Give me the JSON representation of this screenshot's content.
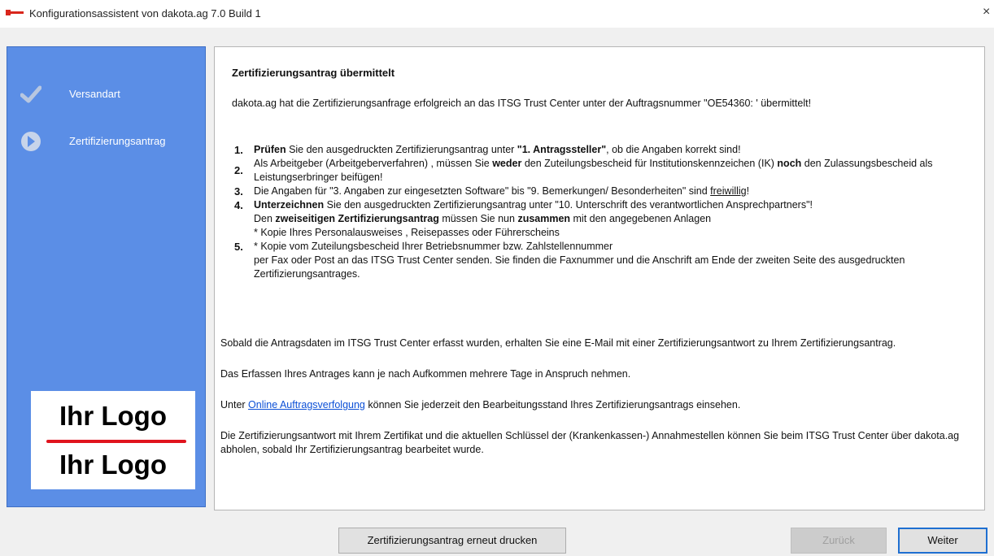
{
  "window": {
    "title": "Konfigurationsassistent von dakota.ag 7.0 Build 1",
    "close": "×"
  },
  "sidebar": {
    "steps": [
      {
        "label": "Versandart",
        "icon": "checkmark-icon",
        "state": "done"
      },
      {
        "label": "Zertifizierungsantrag",
        "icon": "arrow-circle-icon",
        "state": "current"
      }
    ],
    "logo_top": "Ihr Logo",
    "logo_bottom": "Ihr Logo"
  },
  "content": {
    "title": "Zertifizierungsantrag übermittelt",
    "intro": "dakota.ag hat die Zertifizierungsanfrage erfolgreich an das ITSG Trust Center unter der Auftragsnummer \"OE54360: ' übermittelt!",
    "list": {
      "n1": "1.",
      "i1_bold": "Prüfen",
      "i1_rest1": " Sie den ausgedruckten Zertifizierungsantrag unter ",
      "i1_bold2": "\"1. Antragssteller\"",
      "i1_rest2": ", ob die Angaben korrekt sind!",
      "n2": "2.",
      "i2_a": "Als Arbeitgeber (Arbeitgeberverfahren) , müssen Sie ",
      "i2_bold1": "weder",
      "i2_b": " den Zuteilungsbescheid für Institutionskennzeichen (IK) ",
      "i2_bold2": "noch",
      "i2_c": " den Zulassungsbescheid als Leistungserbringer beifügen!",
      "n3": "3.",
      "i3_a": "Die Angaben für \"3. Angaben zur eingesetzten Software\" bis \"9. Bemerkungen/ Besonderheiten\" sind ",
      "i3_u": "freiwillig",
      "i3_b": "!",
      "n4": "4.",
      "i4_bold": "Unterzeichnen",
      "i4_rest": " Sie den ausgedruckten Zertifizierungsantrag unter \"10. Unterschrift des verantwortlichen Ansprechpartners\"!",
      "n5": "5.",
      "i5_a": "Den ",
      "i5_bold1": "zweiseitigen Zertifizierungsantrag",
      "i5_b": " müssen Sie nun ",
      "i5_bold2": "zusammen",
      "i5_c": " mit den angegebenen Anlagen",
      "i5_d": "* Kopie Ihres Personalausweises , Reisepasses oder Führerscheins",
      "i5_e": "* Kopie vom Zuteilungsbescheid Ihrer Betriebsnummer bzw. Zahlstellennummer",
      "i5_f": "per Fax oder Post an das ITSG Trust Center senden. Sie finden die Faxnummer und die Anschrift am Ende der zweiten Seite des ausgedruckten Zertifizierungsantrages."
    },
    "p1": "Sobald die Antragsdaten im ITSG Trust Center erfasst wurden, erhalten Sie eine E-Mail mit einer Zertifizierungsantwort zu Ihrem Zertifizierungsantrag.",
    "p2": "Das Erfassen Ihres Antrages kann je nach Aufkommen mehrere Tage in Anspruch nehmen.",
    "p3_a": "Unter ",
    "p3_link": "Online Auftragsverfolgung",
    "p3_b": " können Sie jederzeit den Bearbeitungsstand Ihres Zertifizierungsantrags einsehen.",
    "p4": "Die Zertifizierungsantwort mit Ihrem Zertifikat und die aktuellen Schlüssel der (Krankenkassen-) Annahmestellen können Sie beim ITSG Trust Center über dakota.ag abholen, sobald Ihr Zertifizierungsantrag bearbeitet wurde."
  },
  "buttons": {
    "print": "Zertifizierungsantrag erneut drucken",
    "back": "Zurück",
    "next": "Weiter"
  }
}
